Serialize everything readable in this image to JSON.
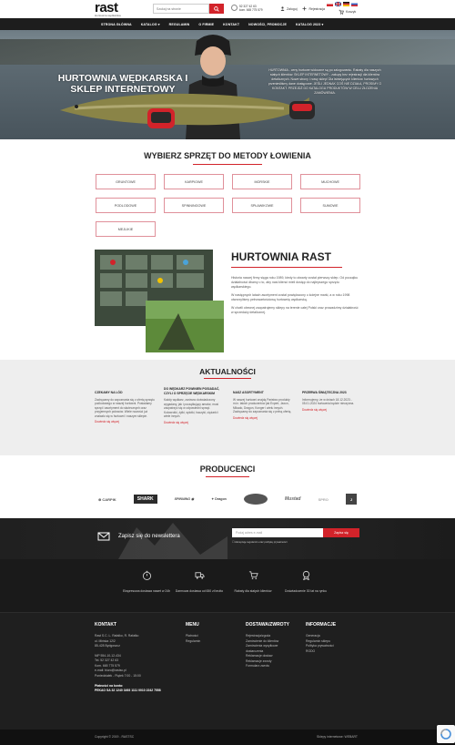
{
  "header": {
    "logo_text": "rast",
    "logo_sub": "Hurtownia wędkarska",
    "search_placeholder": "Szukaj na stronie",
    "contact_phone": "52 327 42 63",
    "contact_extra": "kom. 665 775 579",
    "login_label": "Zaloguj",
    "register_label": "Rejestracja",
    "cart_label": "Koszyk"
  },
  "nav": {
    "items": [
      {
        "label": "STRONA GŁÓWNA"
      },
      {
        "label": "KATALOG ▾"
      },
      {
        "label": "REGULAMIN"
      },
      {
        "label": "O FIRMIE"
      },
      {
        "label": "KONTAKT"
      },
      {
        "label": "NOWOŚCI, PROMOCJE"
      },
      {
        "label": "KATALOG 2023 ▾"
      }
    ]
  },
  "hero": {
    "title": "HURTOWNIA WĘDKARSKA I SKLEP INTERNETOWY",
    "text": "HURTOWNIA - ceny hurtowe widoczne są po zalogowaniu. Rabaty dla naszych stałych klientów. SKLEP INTERNETOWY - zakupy bez rejestracji dla klientów detalicznych. Nowe strony i nowy sklep! Dla istniejących klientów hurtowych przenieśliśmy dane dostępowe. JEŚLI JEDNAK COŚ NIE DZIAŁA, PROSIMY O KONTAKT. PRZEJDŹ DO KATALOGU PRODUKTÓW W CELU ZŁOŻENIA ZAMÓWIENIA."
  },
  "equipment": {
    "title": "WYBIERZ SPRZĘT DO METODY ŁOWIENIA",
    "buttons": [
      {
        "label": "GRUNTOWE"
      },
      {
        "label": "KARPIOWE"
      },
      {
        "label": "MORSKIE"
      },
      {
        "label": "MUCHOWE"
      },
      {
        "label": "PODLODOWE"
      },
      {
        "label": "SPINNINGOWE"
      },
      {
        "label": "SPŁAWIKOWE"
      },
      {
        "label": "SUMOWE"
      },
      {
        "label": "MEJLIKIE"
      }
    ]
  },
  "about": {
    "title": "HURTOWNIA RAST",
    "p1": "Historia naszej firmy sięga roku 1989, kiedy to otwarty został pierwszy sklep. Od początku działalności dbamy o to, aby nasi klienci mieli dostęp do najlepszego sprzętu wędkarskiego.",
    "p2": "W następnych latach asortyment został powiększony o kolejne marki, a w roku 1998 otworzyliśmy pełnowartościową hurtownię wędkarską.",
    "p3": "W chwili obecnej zaopatrujemy sklepy na terenie całej Polski oraz prowadzimy działalność w sprzedaży detalicznej."
  },
  "news": {
    "title": "AKTUALNOŚCI",
    "more_label": "Dowiedz się więcej",
    "items": [
      {
        "heading": "CZEKAMY NA LÓD",
        "text": "Zachęcamy do zapoznania się z ofertą sprzętu podlodowego w naszej hurtowni. Posiadamy sprzęt i asortyment do skutecznych oraz przyjemnych połowów. Wiele nowości już znalazło się w hurtowni i naszym sklepie."
      },
      {
        "heading": "DO WĘDKARZ POWINIEN POSIADAĆ, CZYLI O SPRZĘCIE WĘDKARSKIM",
        "text": "Każdy wędkarz, zarówno doświadczony wygadany, jak i początkujący amator, musi zaopatrzyć się w odpowiedni sprzęt. Kołowrotki, żyłki, splotki, haczyki, ciężarki i wiele innych."
      },
      {
        "heading": "NASZ ASORTYMENT",
        "text": "W naszej hurtowni znajdą Państwo produkty m.in. takich producentów jak Expert, Jaxon, Mikado, Dragon, Konger i wielu innych. Zachęcamy do zapoznania się z pełną ofertą."
      },
      {
        "heading": "PRZERWA ŚWIĄTECZNA 2023",
        "text": "Informujemy, że w dniach 18.12.2023 - 05.01.2024 hurtownia będzie nieczynna."
      }
    ]
  },
  "producers": {
    "title": "PRODUCENCI",
    "brands": [
      {
        "name": "CARPIK"
      },
      {
        "name": "SHARK"
      },
      {
        "name": "SPINNING"
      },
      {
        "name": "Dragon"
      },
      {
        "name": "Mustad"
      },
      {
        "name": "SPRO"
      },
      {
        "name": "J"
      }
    ]
  },
  "newsletter": {
    "label": "Zapisz się do newslettera",
    "input_placeholder": "Podaj adres e-mail",
    "button_label": "Zapisz się",
    "consent": "Akceptuję regulamin oraz politykę prywatności"
  },
  "features": [
    {
      "text": "Ekspresowa dostawa nawet w 24h"
    },
    {
      "text": "Darmowa dostawa od 650 zł brutto"
    },
    {
      "text": "Rabaty dla stałych klientów"
    },
    {
      "text": "Doświadczenie 30 lat na rynku"
    }
  ],
  "footer": {
    "kontakt_title": "KONTAKT",
    "company": "Rast S.C. L. Rafałko, R. Rafałko",
    "street": "ul. Mińska 12/2",
    "city": "85-428 Bydgoszcz",
    "nip": "NIP 554-10-12-434",
    "tel": "Tel. 52 327 42 63",
    "kom": "Kom. 665 775 579",
    "email": "e-mail: biuro@rastsc.pl",
    "hours": "Poniedziałek - Piątek 7:00 - 15:00",
    "bank_label": "Płatności na konto:",
    "bank": "PEKAO SA 32 1240 3493 1111 0010 2242 7558",
    "menu_title": "MENU",
    "menu_items": [
      {
        "label": "Płatności"
      },
      {
        "label": "Regulamin"
      }
    ],
    "dostawa_title": "DOSTAWA/ZWROTY",
    "dostawa_items": [
      {
        "label": "Rejestracja/zgoda"
      },
      {
        "label": "Zamówienie do klientów"
      },
      {
        "label": "Zamówienia wysyłkowe"
      },
      {
        "label": "dostarczenia"
      },
      {
        "label": "Reklamacje dostaw"
      },
      {
        "label": "Reklamacje zwroty"
      },
      {
        "label": "Formularz zwrotu"
      }
    ],
    "info_title": "INFORMACJE",
    "info_items": [
      {
        "label": "Generacja"
      },
      {
        "label": "Regulamin sklepu"
      },
      {
        "label": "Polityka prywatności"
      },
      {
        "label": "RODO"
      }
    ]
  },
  "bottom": {
    "copyright": "Copyright © 2019 - RASTSC",
    "credit": "Sklepy internetowe: WEBART"
  },
  "colors": {
    "accent": "#d2232a",
    "dark": "#1d1d1d"
  }
}
